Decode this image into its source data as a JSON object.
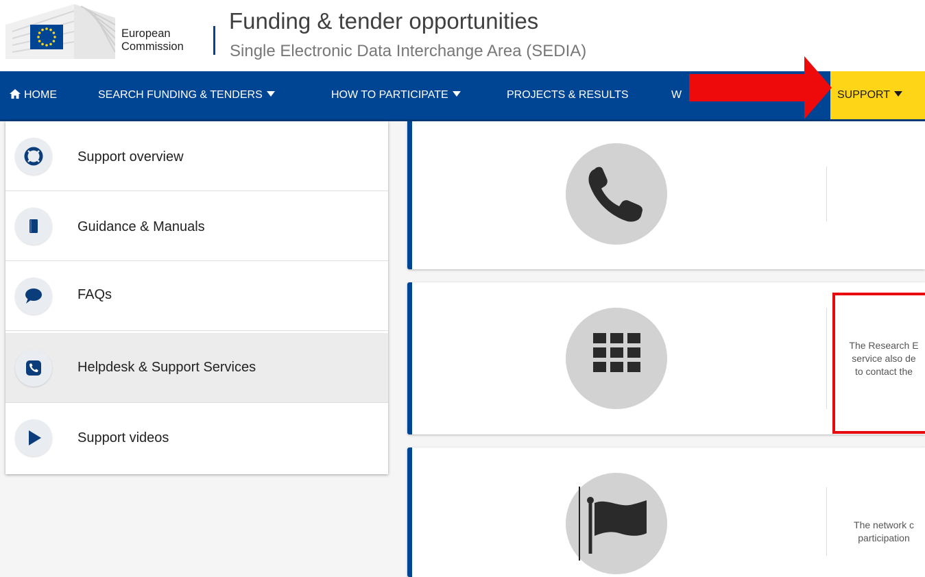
{
  "header": {
    "org_line1": "European",
    "org_line2": "Commission",
    "title": "Funding & tender opportunities",
    "subtitle": "Single Electronic Data Interchange Area (SEDIA)"
  },
  "nav": {
    "home": "HOME",
    "search": "SEARCH FUNDING & TENDERS",
    "participate": "HOW TO PARTICIPATE",
    "projects": "PROJECTS & RESULTS",
    "truncated": "W",
    "support": "SUPPORT"
  },
  "sidebar": {
    "items": [
      {
        "label": "Support overview",
        "icon": "lifebuoy-icon"
      },
      {
        "label": "Guidance & Manuals",
        "icon": "book-icon"
      },
      {
        "label": "FAQs",
        "icon": "speech-bubble-icon"
      },
      {
        "label": "Helpdesk & Support Services",
        "icon": "phone-icon",
        "active": true
      },
      {
        "label": "Support videos",
        "icon": "play-icon"
      }
    ]
  },
  "cards": [
    {
      "icon": "phone-icon",
      "text_lines": []
    },
    {
      "icon": "grid-icon",
      "text_lines": [
        "The Research E",
        "service also de",
        "to contact the"
      ]
    },
    {
      "icon": "flag-icon",
      "text_lines": [
        "The network c",
        "participation"
      ]
    }
  ],
  "colors": {
    "nav_bg": "#004494",
    "support_bg": "#ffd617",
    "annotation_red": "#e8080f"
  }
}
